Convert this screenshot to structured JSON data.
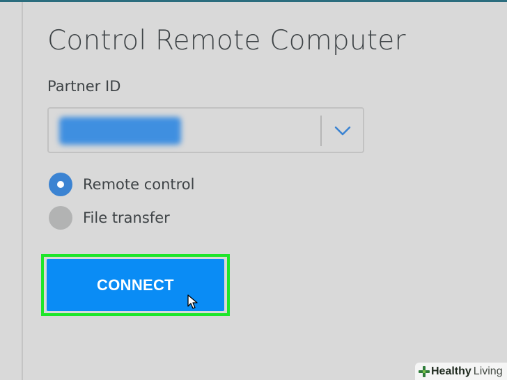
{
  "dialog": {
    "title": "Control Remote Computer",
    "partner_id_label": "Partner ID",
    "partner_id_value": "",
    "options": [
      {
        "label": "Remote control",
        "selected": true
      },
      {
        "label": "File transfer",
        "selected": false
      }
    ],
    "connect_label": "CONNECT"
  },
  "icons": {
    "dropdown": "chevron-down-icon",
    "cursor": "mouse-pointer-icon",
    "logo": "plus-cross-icon"
  },
  "watermark": {
    "brand": "Healthy",
    "sub": "Living"
  },
  "colors": {
    "background": "#d9d9d9",
    "accent": "#0a8cf5",
    "radio_selected": "#3b83d2",
    "radio_unselected": "#b2b3b3",
    "highlight": "#1ee62a",
    "text": "#3e4346"
  }
}
